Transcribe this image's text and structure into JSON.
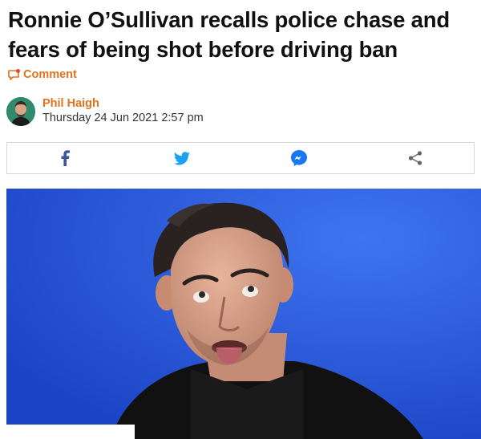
{
  "article": {
    "headline": "Ronnie O’Sullivan recalls police chase and fears of being shot before driving ban",
    "comment_label": "Comment",
    "author_name": "Phil Haigh",
    "published": "Thursday 24 Jun 2021 2:57 pm"
  },
  "share": {
    "items": [
      {
        "icon": "facebook-icon",
        "color": "#3b5998"
      },
      {
        "icon": "twitter-icon",
        "color": "#1da1f2"
      },
      {
        "icon": "messenger-icon",
        "color": "#1877f2"
      },
      {
        "icon": "share-icon",
        "color": "#666666"
      }
    ]
  },
  "colors": {
    "accent": "#e0731c",
    "hero_background": "#1f4fd0"
  }
}
